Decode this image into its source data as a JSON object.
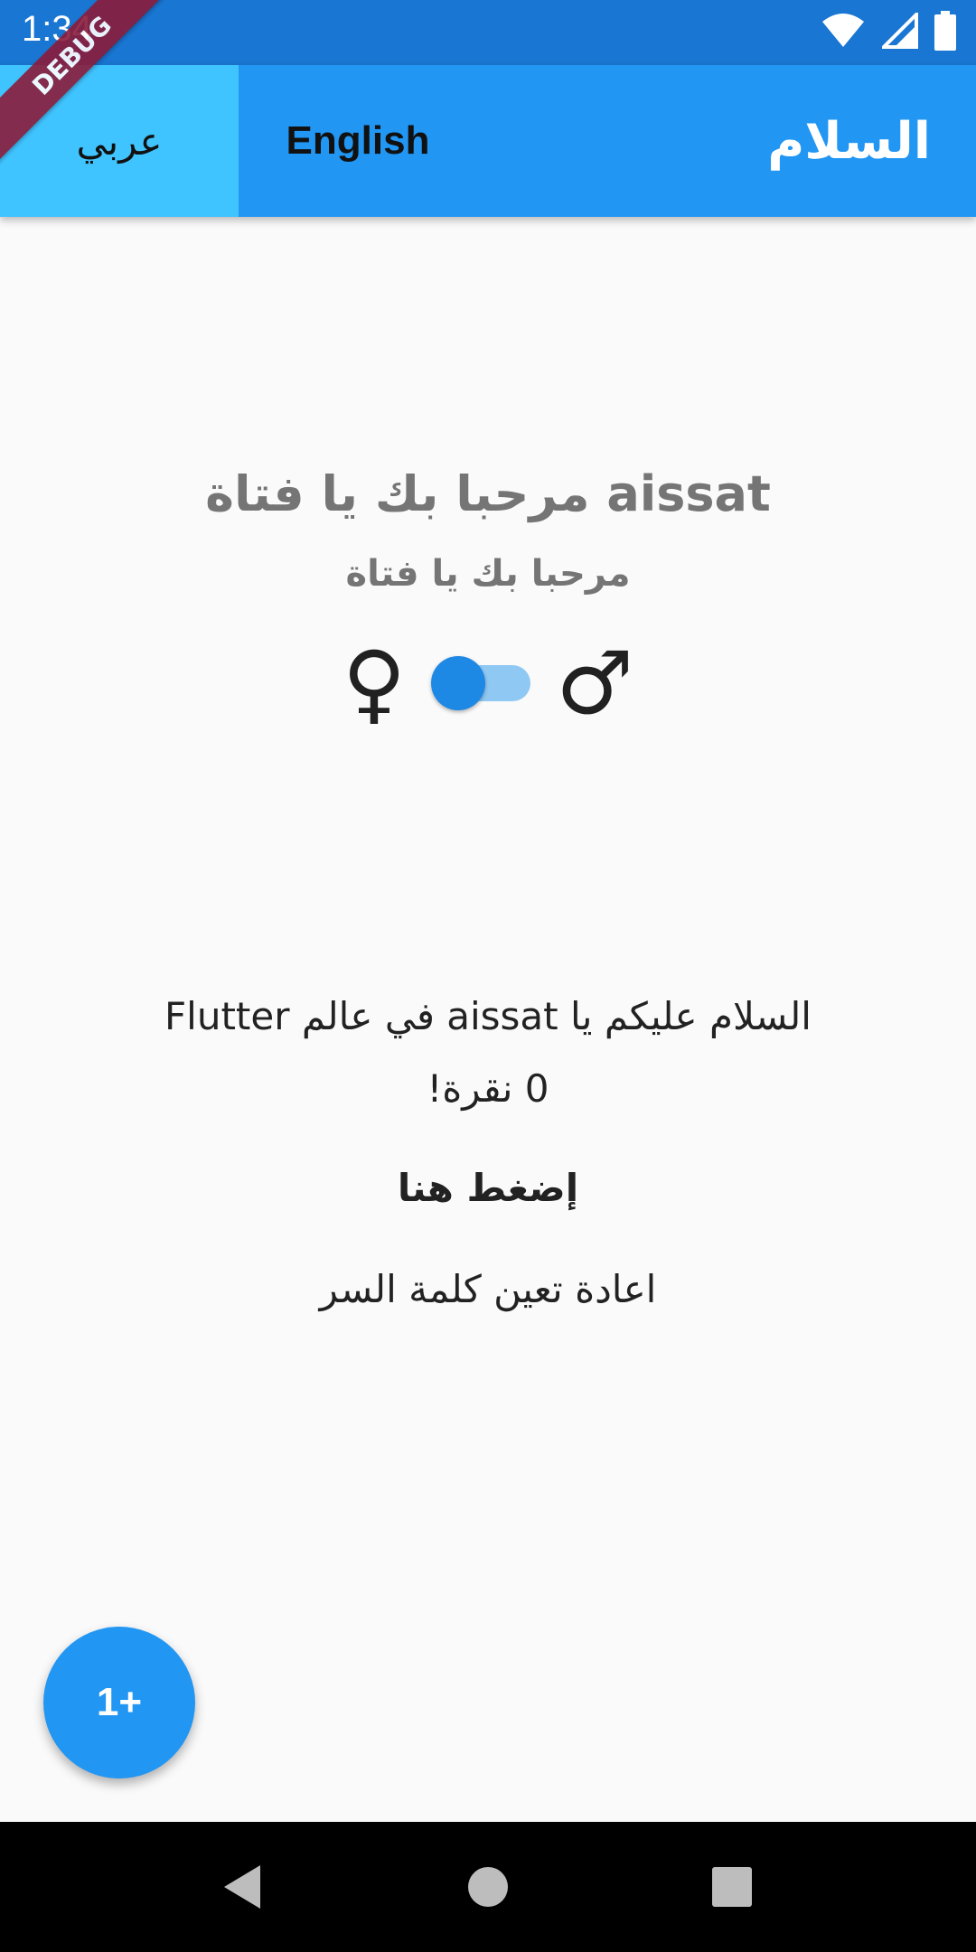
{
  "status_bar": {
    "time": "1:34",
    "icons": [
      "wifi-icon",
      "signal-icon",
      "battery-icon"
    ]
  },
  "debug_banner": "DEBUG",
  "app_bar": {
    "lang_arabic": "عربي",
    "lang_english": "English",
    "title": "السلام"
  },
  "welcome": {
    "title": "aissat مرحبا بك يا فتاة",
    "subtitle": "مرحبا بك يا فتاة",
    "female_symbol": "♀",
    "male_symbol": "♂"
  },
  "body": {
    "greeting": "السلام عليكم يا aissat في عالم Flutter",
    "counter": "0 نقرة!",
    "press_here": "إضغط هنا",
    "reset_password": "اعادة تعين كلمة السر"
  },
  "fab": {
    "label": "1+"
  },
  "colors": {
    "primary": "#2196f3",
    "status": "#1976d2",
    "accent": "#40c4ff"
  }
}
